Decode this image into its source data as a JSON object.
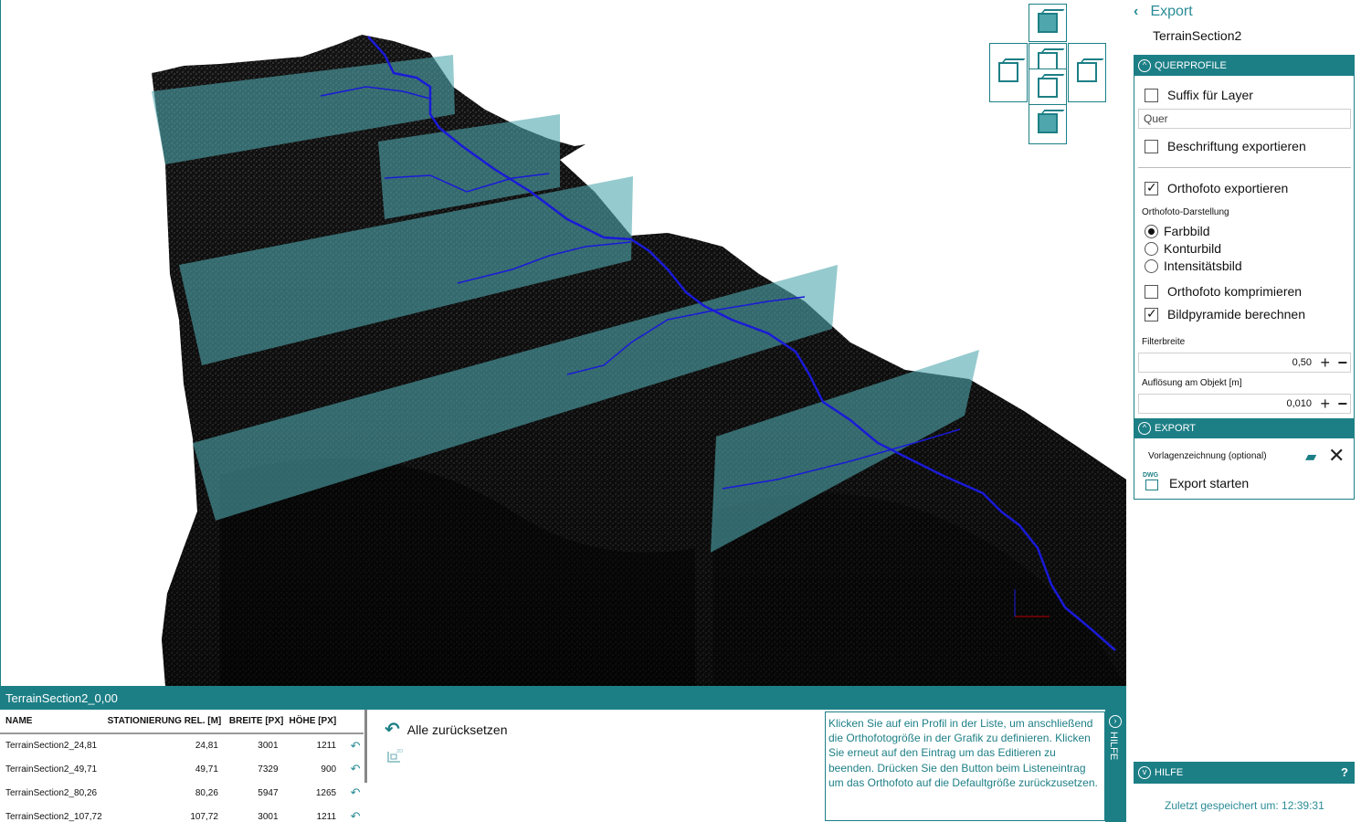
{
  "header": {
    "back_label": "Export",
    "section_name": "TerrainSection2"
  },
  "querprofile": {
    "title": "QUERPROFILE",
    "suffix_label": "Suffix für Layer",
    "suffix_checked": false,
    "suffix_value": "Quer",
    "beschriftung_label": "Beschriftung exportieren",
    "beschriftung_checked": false,
    "orthofoto_label": "Orthofoto exportieren",
    "orthofoto_checked": true,
    "darstellung_label": "Orthofoto-Darstellung",
    "radio_options": [
      "Farbbild",
      "Konturbild",
      "Intensitätsbild"
    ],
    "radio_selected": "Farbbild",
    "komprimieren_label": "Orthofoto komprimieren",
    "komprimieren_checked": false,
    "pyramide_label": "Bildpyramide berechnen",
    "pyramide_checked": true,
    "filterbreite_label": "Filterbreite",
    "filterbreite_value": "0,50",
    "aufloesung_label": "Auflösung am Objekt [m]",
    "aufloesung_value": "0,010"
  },
  "export": {
    "title": "EXPORT",
    "vorlage_label": "Vorlagenzeichnung (optional)",
    "start_label": "Export starten",
    "dwg_badge": "DWG"
  },
  "hilfe": {
    "title": "HILFE",
    "help_symbol": "?",
    "side_label": "HILFE"
  },
  "status": {
    "saved": "Zuletzt gespeichert um: 12:39:31"
  },
  "bottom": {
    "title": "TerrainSection2_0,00",
    "columns": [
      "NAME",
      "STATIONIERUNG REL. [M]",
      "BREITE [PX]",
      "HÖHE [PX]"
    ],
    "rows": [
      [
        "TerrainSection2_24,81",
        "24,81",
        "3001",
        "1211"
      ],
      [
        "TerrainSection2_49,71",
        "49,71",
        "7329",
        "900"
      ],
      [
        "TerrainSection2_80,26",
        "80,26",
        "5947",
        "1265"
      ],
      [
        "TerrainSection2_107,72",
        "107,72",
        "3001",
        "1211"
      ]
    ],
    "reset_all_label": "Alle zurücksetzen",
    "help_text": "Klicken Sie auf ein Profil in der Liste, um anschließend die Orthofotogröße in der Grafik zu definieren. Klicken Sie erneut auf den Eintrag um das Editieren zu beenden. Drücken Sie den Button beim Listeneintrag um das Orthofoto auf die Defaultgröße zurückzusetzen."
  },
  "colors": {
    "accent": "#1d7f86",
    "accent_light": "#2a8c96",
    "plane": "#4fa6ad",
    "route": "#1a1ad8",
    "terrain": "#1c1c1c"
  },
  "icons": [
    "chevron-left-icon",
    "collapse-icon",
    "folder-open-icon",
    "close-icon",
    "dwg-export-icon",
    "undo-icon",
    "profile-2d-icon",
    "question-icon"
  ]
}
